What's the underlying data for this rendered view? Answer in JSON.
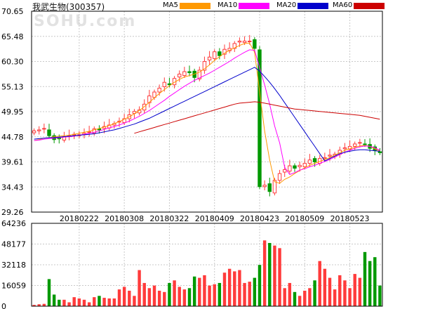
{
  "header": {
    "title": "我武生物(300357)",
    "watermark": "SOHU.com"
  },
  "legend": [
    {
      "name": "MA5",
      "color": "#ff9900"
    },
    {
      "name": "MA10",
      "color": "#ff00ff"
    },
    {
      "name": "MA20",
      "color": "#0000cc"
    },
    {
      "name": "MA60",
      "color": "#cc0000"
    }
  ],
  "colors": {
    "up": "#ff3b3b",
    "down": "#009900",
    "grid": "#c8c8c8",
    "frame": "#000000"
  },
  "chart_data": {
    "type": "candlestick",
    "price_axis": {
      "ticks": [
        "70.65",
        "65.48",
        "60.30",
        "55.13",
        "49.95",
        "44.78",
        "39.61",
        "34.43",
        "29.26"
      ],
      "ylim": [
        29.26,
        70.65
      ]
    },
    "volume_axis": {
      "ticks": [
        "64236",
        "48177",
        "32118",
        "16059",
        "0"
      ],
      "ylim": [
        0,
        64236
      ]
    },
    "x_ticks": [
      "20180222",
      "20180308",
      "20180322",
      "20180409",
      "20180423",
      "20180509",
      "20180523"
    ],
    "x_tick_index": [
      9,
      18,
      27,
      36,
      45,
      54,
      63
    ],
    "n_bars": 70,
    "close": [
      46.0,
      46.2,
      46.5,
      45.0,
      44.2,
      44.4,
      44.8,
      45.0,
      45.3,
      45.2,
      45.5,
      45.8,
      46.4,
      46.2,
      46.9,
      47.2,
      47.5,
      48.0,
      48.5,
      49.3,
      50.0,
      50.3,
      51.5,
      53.2,
      54.0,
      54.8,
      56.0,
      55.5,
      56.8,
      57.7,
      58.2,
      58.0,
      57.0,
      58.5,
      60.3,
      61.2,
      62.3,
      61.5,
      62.8,
      63.0,
      64.0,
      64.5,
      64.5,
      64.5,
      63.0,
      34.5,
      34.8,
      33.5,
      35.8,
      37.2,
      38.0,
      38.8,
      38.3,
      38.9,
      39.3,
      40.0,
      39.6,
      40.3,
      40.5,
      41.0,
      41.2,
      42.0,
      42.5,
      42.8,
      43.3,
      43.6,
      43.2,
      42.4,
      42.0,
      41.5
    ],
    "volume": [
      1000,
      1500,
      1800,
      21000,
      9000,
      5000,
      5000,
      3000,
      7000,
      6000,
      5000,
      3000,
      7000,
      8000,
      6500,
      6000,
      6000,
      13000,
      15000,
      12000,
      8000,
      28000,
      18000,
      14000,
      16000,
      12000,
      11000,
      18000,
      20000,
      15000,
      13000,
      14000,
      23000,
      22000,
      24000,
      16000,
      17000,
      18000,
      26000,
      29000,
      27000,
      28000,
      18000,
      19000,
      22000,
      32000,
      51000,
      49000,
      47000,
      45000,
      14000,
      18000,
      11000,
      8000,
      12000,
      14000,
      20000,
      35000,
      29000,
      22000,
      13000,
      24000,
      20000,
      14000,
      25000,
      22000,
      42000,
      35000,
      38000,
      16000
    ],
    "ma5": [
      44.0,
      44.2,
      44.5,
      44.6,
      44.8,
      44.9,
      45.0,
      45.1,
      45.3,
      45.5,
      45.7,
      45.9,
      46.2,
      46.5,
      46.8,
      47.1,
      47.5,
      47.9,
      48.4,
      48.9,
      49.5,
      50.2,
      51.0,
      51.9,
      52.8,
      53.7,
      54.5,
      55.3,
      56.0,
      56.6,
      57.1,
      57.4,
      57.7,
      58.1,
      58.8,
      59.6,
      60.5,
      61.3,
      62.0,
      62.6,
      63.1,
      63.6,
      64.0,
      64.1,
      62.2,
      54.0,
      46.0,
      40.0,
      35.5,
      35.2,
      36.0,
      36.5,
      37.2,
      37.8,
      38.4,
      38.9,
      39.3,
      39.7,
      40.1,
      40.5,
      41.0,
      41.5,
      42.0,
      42.3,
      42.6,
      42.9,
      43.0,
      42.8,
      42.3,
      41.8
    ],
    "ma10": [
      44.0,
      44.1,
      44.3,
      44.4,
      44.5,
      44.6,
      44.7,
      44.8,
      44.9,
      45.1,
      45.3,
      45.5,
      45.7,
      46.0,
      46.3,
      46.6,
      46.9,
      47.2,
      47.6,
      48.0,
      48.5,
      49.0,
      49.6,
      50.2,
      50.9,
      51.6,
      52.3,
      53.1,
      53.8,
      54.5,
      55.2,
      55.8,
      56.4,
      56.9,
      57.4,
      57.9,
      58.5,
      59.1,
      59.7,
      60.3,
      61.0,
      61.6,
      62.2,
      62.7,
      62.6,
      59.0,
      55.5,
      51.5,
      47.0,
      43.5,
      38.5,
      37.0,
      37.4,
      37.9,
      38.2,
      38.6,
      38.9,
      39.3,
      39.7,
      40.1,
      40.6,
      41.1,
      41.6,
      42.0,
      42.4,
      42.7,
      42.9,
      42.8,
      42.5,
      42.0
    ],
    "ma20": [
      44.3,
      44.4,
      44.5,
      44.6,
      44.6,
      44.7,
      44.8,
      44.9,
      45.0,
      45.1,
      45.2,
      45.3,
      45.4,
      45.6,
      45.8,
      46.0,
      46.2,
      46.5,
      46.8,
      47.1,
      47.4,
      47.8,
      48.2,
      48.6,
      49.1,
      49.6,
      50.1,
      50.6,
      51.1,
      51.6,
      52.1,
      52.6,
      53.1,
      53.6,
      54.1,
      54.6,
      55.1,
      55.6,
      56.1,
      56.6,
      57.1,
      57.6,
      58.1,
      58.6,
      59.1,
      58.3,
      57.2,
      56.0,
      54.7,
      53.3,
      51.8,
      50.3,
      48.8,
      47.3,
      45.8,
      44.3,
      42.8,
      41.3,
      39.8,
      40.3,
      40.8,
      41.3,
      41.6,
      41.8,
      42.0,
      42.1,
      42.1,
      42.0,
      41.9,
      41.8
    ],
    "ma60": [
      null,
      null,
      null,
      null,
      null,
      null,
      null,
      null,
      null,
      null,
      null,
      null,
      null,
      null,
      null,
      null,
      null,
      null,
      null,
      null,
      45.5,
      45.8,
      46.1,
      46.4,
      46.7,
      47.0,
      47.3,
      47.6,
      47.9,
      48.2,
      48.5,
      48.8,
      49.1,
      49.4,
      49.7,
      50.0,
      50.3,
      50.6,
      50.9,
      51.2,
      51.5,
      51.7,
      51.8,
      51.9,
      52.0,
      51.9,
      51.7,
      51.5,
      51.3,
      51.1,
      50.9,
      50.7,
      50.5,
      50.4,
      50.3,
      50.2,
      50.1,
      50.0,
      49.9,
      49.8,
      49.7,
      49.6,
      49.5,
      49.4,
      49.3,
      49.2,
      49.0,
      48.8,
      48.6,
      48.4
    ]
  }
}
